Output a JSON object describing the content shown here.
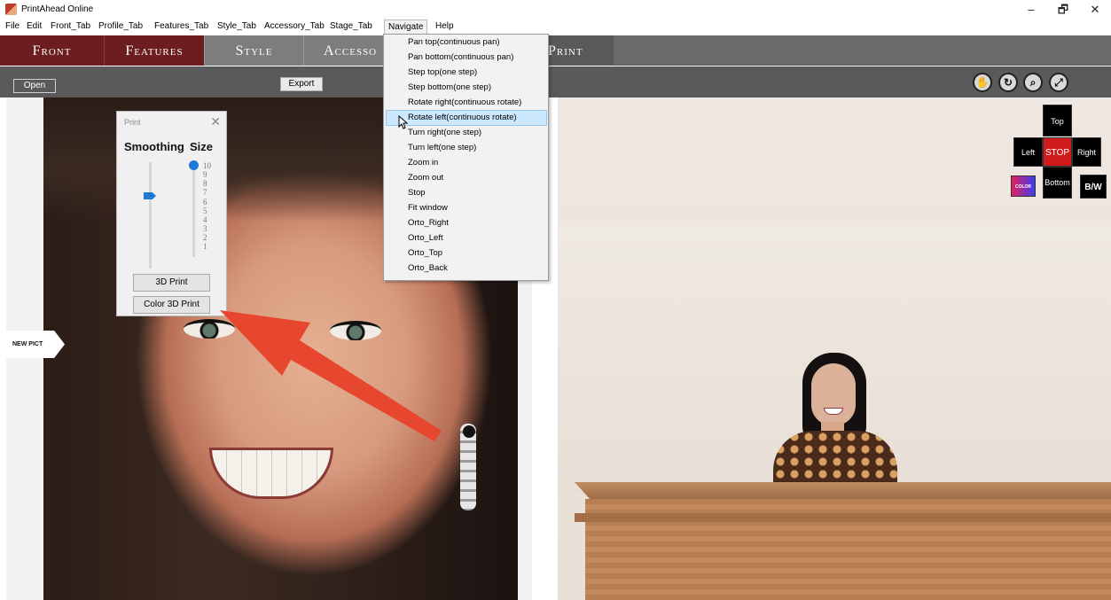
{
  "window": {
    "title": "PrintAhead Online",
    "minimize_glyph": "–",
    "restore_glyph": "🗗",
    "close_glyph": "✕"
  },
  "menubar": {
    "items": [
      "File",
      "Edit",
      "Front_Tab",
      "Profile_Tab",
      "Features_Tab",
      "Style_Tab",
      "Accessory_Tab",
      "Stage_Tab",
      "Navigate",
      "Help"
    ],
    "open_menu": "Navigate"
  },
  "tabs": {
    "front": "Front",
    "features": "Features",
    "style": "Style",
    "accessory": "Accesso",
    "print": "Print"
  },
  "toolbar": {
    "open_label": "Open",
    "export_label": "Export",
    "nav_icons": [
      "hand-icon",
      "rotate-icon",
      "zoom-in-icon",
      "zoom-out-icon"
    ]
  },
  "left": {
    "new_pict_label": "NEW PICT"
  },
  "print_dialog": {
    "title": "Print",
    "close_glyph": "✕",
    "smoothing_label": "Smoothing",
    "size_label": "Size",
    "size_ticks": [
      "10",
      "9",
      "8",
      "7",
      "6",
      "5",
      "4",
      "3",
      "2",
      "1"
    ],
    "size_value": 10,
    "smoothing_value_fraction": 0.27,
    "btn_3d_print": "3D Print",
    "btn_color_3d_print": "Color 3D Print"
  },
  "navigate_menu": {
    "items": [
      "Pan top(continuous pan)",
      "Pan bottom(continuous pan)",
      "Step top(one step)",
      "Step bottom(one step)",
      "Rotate right(continuous rotate)",
      "Rotate left(continuous rotate)",
      "Turn right(one step)",
      "Turn left(one step)",
      "Zoom in",
      "Zoom out",
      "Stop",
      "Fit window",
      "Orto_Right",
      "Orto_Left",
      "Orto_Top",
      "Orto_Back"
    ],
    "highlighted": "Rotate left(continuous rotate)"
  },
  "view_controls": {
    "top": "Top",
    "left": "Left",
    "stop": "STOP",
    "right": "Right",
    "bottom": "Bottom",
    "color": "COLOR",
    "bw": "B/W"
  },
  "colors": {
    "tab_active_bg": "#6b1d20",
    "toolbar_bg": "#5a5a5a",
    "stop_red": "#d11b1b",
    "menu_highlight": "#cce8ff",
    "arrow_red": "#e8472f",
    "slider_blue": "#1e78d6"
  }
}
